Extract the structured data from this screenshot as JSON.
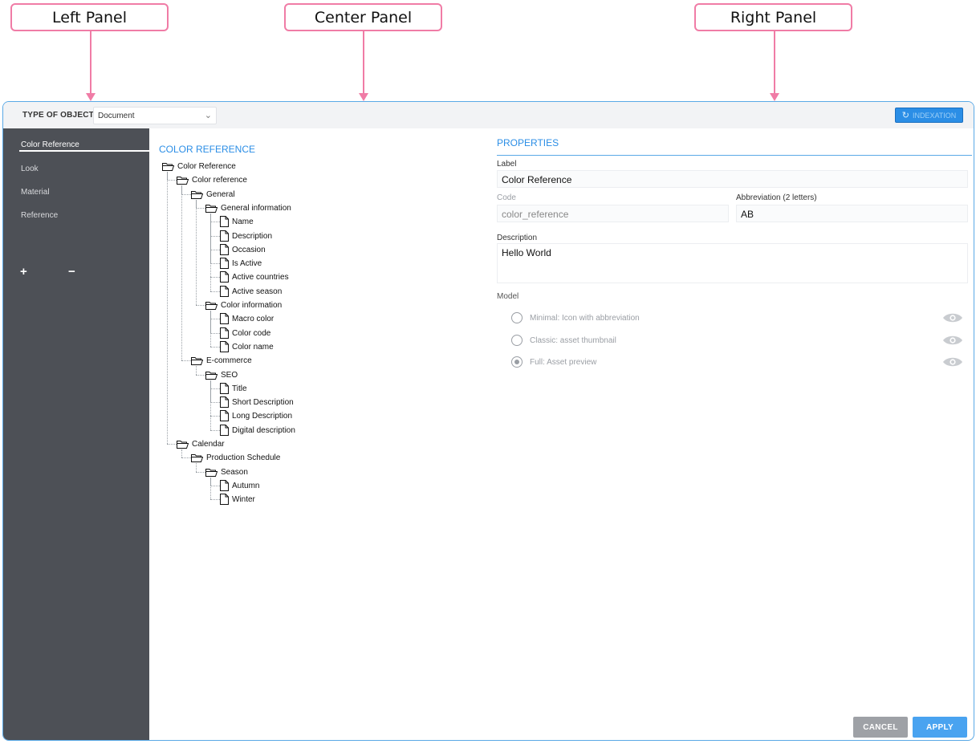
{
  "annotations": {
    "left": "Left Panel",
    "center": "Center Panel",
    "right": "Right Panel"
  },
  "topbar": {
    "type_label": "TYPE OF OBJECT",
    "type_value": "Document",
    "indexation_label": "INDEXATION"
  },
  "sidebar": {
    "items": [
      {
        "label": "Color Reference",
        "active": true
      },
      {
        "label": "Look"
      },
      {
        "label": "Material"
      },
      {
        "label": "Reference"
      }
    ],
    "add_symbol": "+",
    "remove_symbol": "−"
  },
  "tree": {
    "title": "COLOR REFERENCE",
    "nodes": [
      {
        "label": "Color Reference",
        "type": "folder",
        "level": 0
      },
      {
        "label": "Color reference",
        "type": "folder",
        "level": 1
      },
      {
        "label": "General",
        "type": "folder",
        "level": 2
      },
      {
        "label": "General information",
        "type": "folder",
        "level": 3
      },
      {
        "label": "Name",
        "type": "file",
        "level": 4
      },
      {
        "label": "Description",
        "type": "file",
        "level": 4
      },
      {
        "label": "Occasion",
        "type": "file",
        "level": 4
      },
      {
        "label": "Is Active",
        "type": "file",
        "level": 4
      },
      {
        "label": "Active countries",
        "type": "file",
        "level": 4
      },
      {
        "label": "Active season",
        "type": "file",
        "level": 4
      },
      {
        "label": "Color information",
        "type": "folder",
        "level": 3
      },
      {
        "label": "Macro color",
        "type": "file",
        "level": 4
      },
      {
        "label": "Color code",
        "type": "file",
        "level": 4
      },
      {
        "label": "Color name",
        "type": "file",
        "level": 4
      },
      {
        "label": "E-commerce",
        "type": "folder",
        "level": 2
      },
      {
        "label": "SEO",
        "type": "folder",
        "level": 3
      },
      {
        "label": "Title",
        "type": "file",
        "level": 4
      },
      {
        "label": "Short Description",
        "type": "file",
        "level": 4
      },
      {
        "label": "Long Description",
        "type": "file",
        "level": 4
      },
      {
        "label": "Digital description",
        "type": "file",
        "level": 4
      },
      {
        "label": "Calendar",
        "type": "folder",
        "level": 1
      },
      {
        "label": "Production Schedule",
        "type": "folder",
        "level": 2
      },
      {
        "label": "Season",
        "type": "folder",
        "level": 3
      },
      {
        "label": "Autumn",
        "type": "file",
        "level": 4
      },
      {
        "label": "Winter",
        "type": "file",
        "level": 4
      }
    ]
  },
  "properties": {
    "title": "PROPERTIES",
    "label_label": "Label",
    "label_value": "Color Reference",
    "code_label": "Code",
    "code_value": "color_reference",
    "abbr_label": "Abbreviation (2 letters)",
    "abbr_value": "AB",
    "desc_label": "Description",
    "desc_value": "Hello World",
    "model_label": "Model",
    "model_options": [
      {
        "label": "Minimal: Icon with abbreviation",
        "checked": false
      },
      {
        "label": "Classic: asset thumbnail",
        "checked": false
      },
      {
        "label": "Full: Asset preview",
        "checked": true
      }
    ]
  },
  "actions": {
    "cancel": "CANCEL",
    "apply": "APPLY"
  },
  "colors": {
    "accent": "#2b8ee6",
    "sidebar_bg": "#4d5056",
    "annotation": "#f07ca6"
  }
}
